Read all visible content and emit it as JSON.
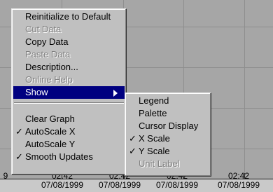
{
  "context_menu": {
    "items": [
      {
        "label": "Reinitialize to Default",
        "enabled": true,
        "checked": false
      },
      {
        "label": "Cut Data",
        "enabled": false,
        "checked": false
      },
      {
        "label": "Copy Data",
        "enabled": true,
        "checked": false
      },
      {
        "label": "Paste Data",
        "enabled": false,
        "checked": false
      },
      {
        "label": "Description...",
        "enabled": true,
        "checked": false
      },
      {
        "label": "Online Help",
        "enabled": false,
        "checked": false
      },
      {
        "label": "Show",
        "enabled": true,
        "checked": false,
        "highlighted": true,
        "submenu": true
      },
      {
        "label": "Clear Graph",
        "enabled": true,
        "checked": false
      },
      {
        "label": "AutoScale X",
        "enabled": true,
        "checked": true
      },
      {
        "label": "AutoScale Y",
        "enabled": true,
        "checked": false
      },
      {
        "label": "Smooth Updates",
        "enabled": true,
        "checked": true
      }
    ]
  },
  "show_submenu": {
    "items": [
      {
        "label": "Legend",
        "enabled": true,
        "checked": false
      },
      {
        "label": "Palette",
        "enabled": true,
        "checked": false
      },
      {
        "label": "Cursor Display",
        "enabled": true,
        "checked": false
      },
      {
        "label": "X Scale",
        "enabled": true,
        "checked": true
      },
      {
        "label": "Y Scale",
        "enabled": true,
        "checked": true
      },
      {
        "label": "Unit Label",
        "enabled": false,
        "checked": false
      }
    ]
  },
  "check_glyph": "✓",
  "x_axis": {
    "labels": [
      {
        "time": "",
        "date": "9"
      },
      {
        "time": "02:42",
        "date": "07/08/1999"
      },
      {
        "time": "02:42",
        "date": "07/08/1999"
      },
      {
        "time": "02:42",
        "date": "07/08/1999"
      },
      {
        "time": "02:42",
        "date": "07/08/1999"
      }
    ]
  },
  "colors": {
    "highlight": "#000080",
    "menu_bg": "#c0c0c0",
    "plot_bg": "#a6a6a6"
  }
}
